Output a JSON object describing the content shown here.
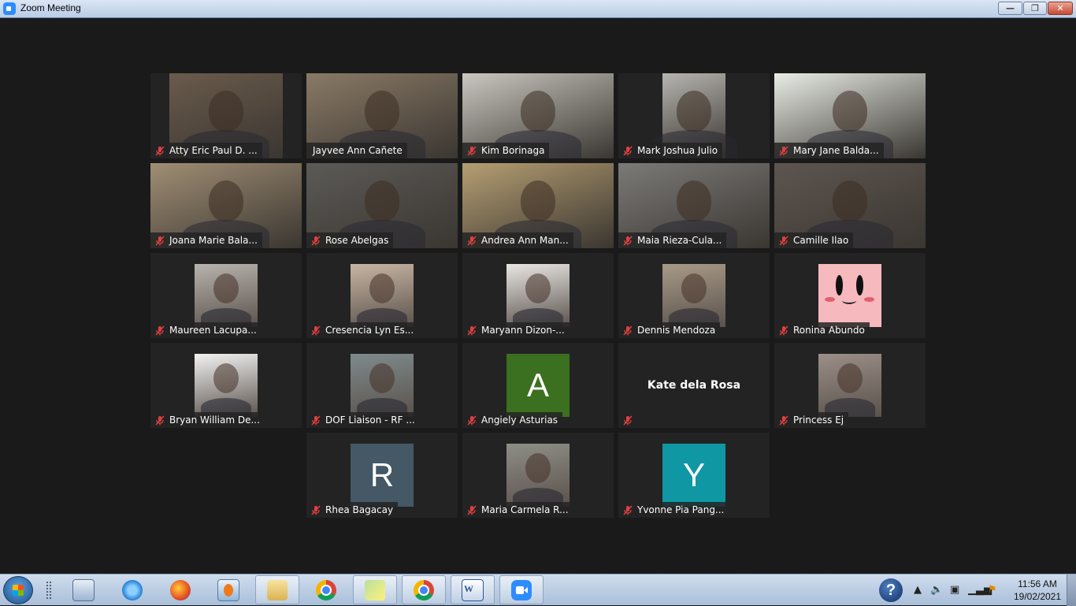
{
  "window": {
    "title": "Zoom Meeting",
    "controls": {
      "minimize": "—",
      "maximize": "❐",
      "close": "✕"
    }
  },
  "participants": [
    {
      "name": "Atty Eric Paul D. ...",
      "muted": true,
      "type": "video",
      "bg": "#6a5b4c",
      "active": false
    },
    {
      "name": "Jayvee Ann Cañete",
      "muted": false,
      "type": "video",
      "bg": "#8a7a66",
      "active": true
    },
    {
      "name": "Kim Borinaga",
      "muted": true,
      "type": "video",
      "bg": "#c9c7c0",
      "active": false
    },
    {
      "name": "Mark Joshua Julio",
      "muted": true,
      "type": "video",
      "bg": "#b7b5b1",
      "active": false
    },
    {
      "name": "Mary Jane Balda...",
      "muted": true,
      "type": "video",
      "bg": "#e9ece6",
      "active": false
    },
    {
      "name": "Joana Marie Bala...",
      "muted": true,
      "type": "video",
      "bg": "#a08e74",
      "active": false
    },
    {
      "name": "Rose Abelgas",
      "muted": true,
      "type": "video",
      "bg": "#5c5a57",
      "active": false
    },
    {
      "name": "Andrea Ann Man...",
      "muted": true,
      "type": "video",
      "bg": "#b59e72",
      "active": false
    },
    {
      "name": "Maia Rieza-Cula...",
      "muted": true,
      "type": "video",
      "bg": "#7c7a78",
      "active": false
    },
    {
      "name": "Camille Ilao",
      "muted": true,
      "type": "video",
      "bg": "#5e5550",
      "active": false
    },
    {
      "name": "Maureen Lacupa...",
      "muted": true,
      "type": "photo",
      "bg": "#b8b3ae",
      "active": false
    },
    {
      "name": "Cresencia Lyn Es...",
      "muted": true,
      "type": "photo",
      "bg": "#c8b5a3",
      "active": false
    },
    {
      "name": "Maryann Dizon-...",
      "muted": true,
      "type": "photo",
      "bg": "#e8e6e3",
      "active": false
    },
    {
      "name": "Dennis Mendoza",
      "muted": true,
      "type": "photo",
      "bg": "#a89a88",
      "active": false
    },
    {
      "name": "Ronina Abundo",
      "muted": true,
      "type": "kirby",
      "bg": "#f6b9bd",
      "active": false
    },
    {
      "name": "Bryan William De...",
      "muted": true,
      "type": "photo",
      "bg": "#f2f2f2",
      "active": false
    },
    {
      "name": "DOF Liaison - RF ...",
      "muted": true,
      "type": "photo",
      "bg": "#7f8a8c",
      "active": false
    },
    {
      "name": "Angiely Asturias",
      "muted": true,
      "type": "initial",
      "initial": "A",
      "bg": "#3a7020",
      "active": false
    },
    {
      "name": "Kate dela Rosa",
      "muted": true,
      "type": "name-only",
      "bg": "#232323",
      "active": false
    },
    {
      "name": "Princess Ej",
      "muted": true,
      "type": "photo",
      "bg": "#9b8f88",
      "active": false
    },
    {
      "name": "Rhea Bagacay",
      "muted": true,
      "type": "initial",
      "initial": "R",
      "bg": "#445866",
      "active": false
    },
    {
      "name": "Maria Carmela R...",
      "muted": true,
      "type": "photo",
      "bg": "#8e8e86",
      "active": false
    },
    {
      "name": "Yvonne Pia Pang...",
      "muted": true,
      "type": "initial",
      "initial": "Y",
      "bg": "#0f97a4",
      "active": false
    }
  ],
  "taskbar": {
    "pinned": [
      {
        "name": "calculator",
        "open": false
      },
      {
        "name": "internet-explorer",
        "open": false
      },
      {
        "name": "firefox",
        "open": false
      },
      {
        "name": "media-player",
        "open": false
      },
      {
        "name": "file-explorer",
        "open": true
      },
      {
        "name": "chrome",
        "open": false
      },
      {
        "name": "sticky-notes",
        "open": true
      },
      {
        "name": "chrome-profile",
        "open": true
      },
      {
        "name": "word",
        "open": true
      },
      {
        "name": "zoom",
        "open": true
      }
    ],
    "help_label": "?",
    "tray": {
      "time": "11:56 AM",
      "date": "19/02/2021"
    }
  }
}
